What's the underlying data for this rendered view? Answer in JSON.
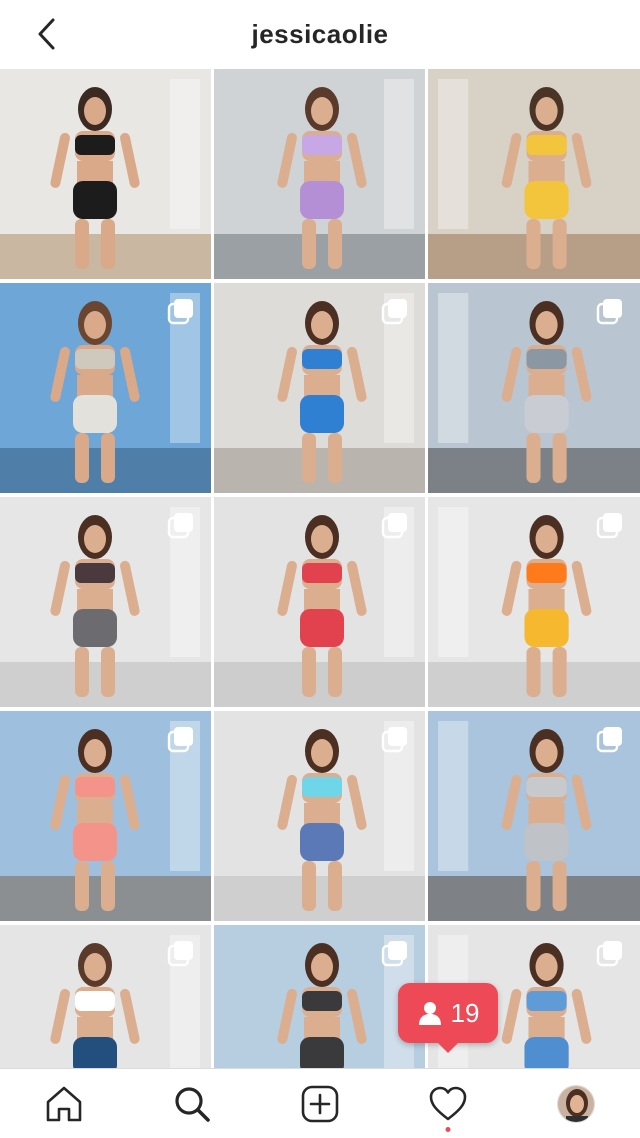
{
  "header": {
    "title": "jessicaolie",
    "back_icon": "chevron-left-icon"
  },
  "grid": {
    "tiles": [
      {
        "bg": "#e9e7e4",
        "floor": "#c9b7a2",
        "skin": "#d9a98a",
        "hair": "#3b2a22",
        "top": "#1c1c1c",
        "bottom": "#1c1c1c",
        "multi": false
      },
      {
        "bg": "#cfd3d6",
        "floor": "#9aa0a4",
        "skin": "#dcae90",
        "hair": "#5a3a2a",
        "top": "#c8a7e6",
        "bottom": "#b48fd6",
        "multi": false
      },
      {
        "bg": "#d8d2c6",
        "floor": "#b79e86",
        "skin": "#dcae90",
        "hair": "#4a3426",
        "top": "#f2c53d",
        "bottom": "#f2c53d",
        "multi": false
      },
      {
        "bg": "#6fa6d8",
        "floor": "#4f7ea8",
        "skin": "#d9a98a",
        "hair": "#6a4530",
        "top": "#cfc9bd",
        "bottom": "#e3e1dc",
        "multi": true
      },
      {
        "bg": "#dedcd8",
        "floor": "#b9b4ad",
        "skin": "#dcae90",
        "hair": "#4a2f22",
        "top": "#2f7fd3",
        "bottom": "#2f7fd3",
        "multi": true
      },
      {
        "bg": "#b9c6d2",
        "floor": "#7b8186",
        "skin": "#dcae90",
        "hair": "#4a2f22",
        "top": "#8b97a3",
        "bottom": "#c9ccd3",
        "multi": true
      },
      {
        "bg": "#e6e6e6",
        "floor": "#cfcfcf",
        "skin": "#dcae90",
        "hair": "#4a2f22",
        "top": "#4a3a3f",
        "bottom": "#6b6b70",
        "multi": true
      },
      {
        "bg": "#e3e3e3",
        "floor": "#cdcdcd",
        "skin": "#dcae90",
        "hair": "#4a2f22",
        "top": "#e2424e",
        "bottom": "#e2424e",
        "multi": true
      },
      {
        "bg": "#e6e6e6",
        "floor": "#cfcfcf",
        "skin": "#dcae90",
        "hair": "#4a2f22",
        "top": "#ff7a1a",
        "bottom": "#f5b82e",
        "multi": true
      },
      {
        "bg": "#9ec0de",
        "floor": "#8c8f92",
        "skin": "#dcae90",
        "hair": "#4a2f22",
        "top": "#f4938a",
        "bottom": "#f4938a",
        "multi": true
      },
      {
        "bg": "#e3e3e3",
        "floor": "#cfcfcf",
        "skin": "#dcae90",
        "hair": "#4a2f22",
        "top": "#6fd6ea",
        "bottom": "#5b79b6",
        "multi": true
      },
      {
        "bg": "#a9c4dc",
        "floor": "#7e8287",
        "skin": "#dcae90",
        "hair": "#4a2f22",
        "top": "#c7c9cd",
        "bottom": "#bfc2c6",
        "multi": true
      },
      {
        "bg": "#e5e5e5",
        "floor": "#cfcfcf",
        "skin": "#dcae90",
        "hair": "#5a3a2a",
        "top": "#ffffff",
        "bottom": "#234f7e",
        "multi": true
      },
      {
        "bg": "#b7cde0",
        "floor": "#7e8287",
        "skin": "#dcae90",
        "hair": "#4a2f22",
        "top": "#3a3a3d",
        "bottom": "#3a3a3d",
        "multi": true
      },
      {
        "bg": "#e5e5e5",
        "floor": "#cfcfcf",
        "skin": "#dcae90",
        "hair": "#4a2f22",
        "top": "#5f9bd6",
        "bottom": "#4f8ed0",
        "multi": true
      }
    ]
  },
  "notification": {
    "count": "19",
    "icon": "person-icon",
    "color": "#ed4956"
  },
  "nav": {
    "items": [
      {
        "name": "home",
        "icon": "home-icon"
      },
      {
        "name": "search",
        "icon": "search-icon"
      },
      {
        "name": "new-post",
        "icon": "plus-square-icon"
      },
      {
        "name": "activity",
        "icon": "heart-icon"
      },
      {
        "name": "profile",
        "icon": "avatar"
      }
    ]
  }
}
